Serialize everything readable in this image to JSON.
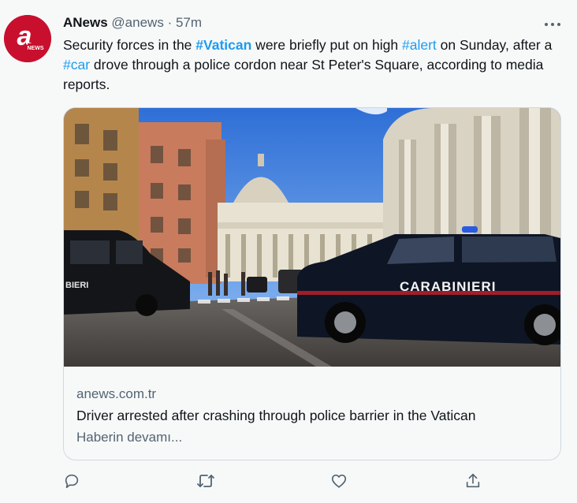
{
  "author": {
    "name": "ANews",
    "handle": "@anews",
    "separator": "·",
    "time": "57m",
    "avatar_letter": "a",
    "avatar_word": "NEWS",
    "avatar_color": "#c8102e"
  },
  "tweet": {
    "part1": "Security forces in the ",
    "hashtag1": "#Vatican",
    "part2": " were briefly put on high ",
    "hashtag2": "#alert",
    "part3": " on Sunday, after a ",
    "hashtag3": "#car",
    "part4": " drove through a police cordon near St Peter's Square, according to media reports."
  },
  "card": {
    "image_vehicle_text": "CARABINIERI",
    "image_vehicle_text_partial": "BIERI",
    "domain": "anews.com.tr",
    "title": "Driver arrested after crashing through police barrier in the Vatican",
    "description": "Haberin devamı..."
  },
  "icons": {
    "more": "more-horizontal-icon",
    "reply": "reply-icon",
    "retweet": "retweet-icon",
    "like": "like-heart-icon",
    "share": "share-icon"
  },
  "colors": {
    "link": "#1d9bf0",
    "text": "#0f1419",
    "secondary": "#536471",
    "border": "#cfd9de"
  }
}
